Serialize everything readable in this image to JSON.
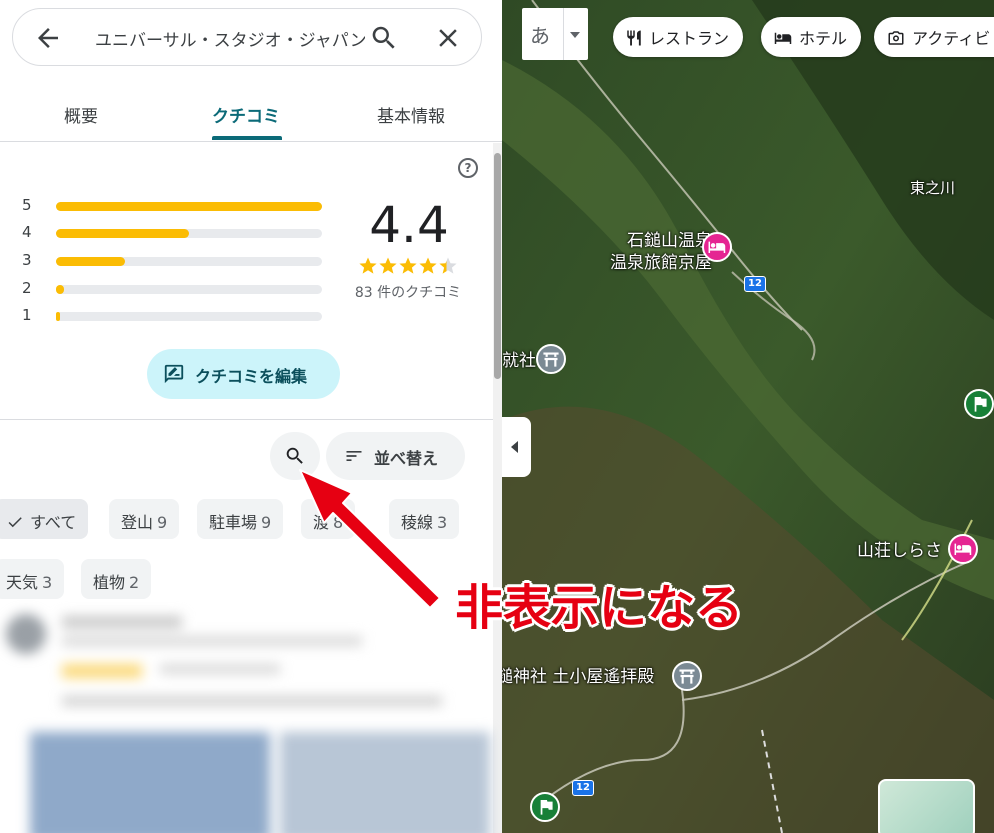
{
  "search": {
    "query": "ユニバーサル・スタジオ・ジャパン"
  },
  "tabs": [
    {
      "label": "概要"
    },
    {
      "label": "クチコミ"
    },
    {
      "label": "基本情報"
    }
  ],
  "rating": {
    "value": "4.4",
    "stars": 4.4,
    "count_text": "83 件のクチコミ",
    "help": "?",
    "distribution": [
      {
        "label": "5",
        "fraction": 1.0
      },
      {
        "label": "4",
        "fraction": 0.5
      },
      {
        "label": "3",
        "fraction": 0.26
      },
      {
        "label": "2",
        "fraction": 0.03
      },
      {
        "label": "1",
        "fraction": 0.01
      }
    ]
  },
  "actions": {
    "edit_review": "クチコミを編集",
    "sort": "並べ替え"
  },
  "topics": [
    {
      "label": "すべて",
      "count": "",
      "selected": true
    },
    {
      "label": "登山",
      "count": "9"
    },
    {
      "label": "駐車場",
      "count": "9"
    },
    {
      "label": "渡",
      "count": "8"
    },
    {
      "label": "稜線",
      "count": "3"
    },
    {
      "label": "天気",
      "count": "3"
    },
    {
      "label": "植物",
      "count": "2"
    }
  ],
  "map": {
    "lang_label": "あ",
    "chips": [
      {
        "label": "レストラン",
        "icon": "fork-knife-icon"
      },
      {
        "label": "ホテル",
        "icon": "bed-icon"
      },
      {
        "label": "アクティビ",
        "icon": "camera-icon"
      }
    ],
    "labels": {
      "east_river": "東之川",
      "onsen_line1": "石鎚山温泉",
      "onsen_line2": "温泉旅館京屋",
      "shrine1": "就社",
      "sanso": "山荘しらさ",
      "shrine2": "鎚神社 土小屋遙拝殿"
    },
    "road_numbers": [
      "12",
      "12"
    ]
  },
  "annotation": {
    "text": "非表示になる",
    "color": "#e60012"
  }
}
